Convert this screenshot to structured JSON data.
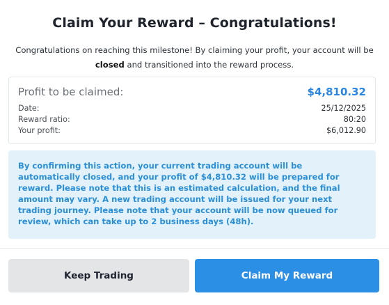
{
  "dialog": {
    "title": "Claim Your Reward – Congratulations!",
    "subtitle_part1": "Congratulations on reaching this milestone! By claiming your profit, your account will be ",
    "subtitle_bold": "closed",
    "subtitle_part2": " and transitioned into the reward process."
  },
  "summary": {
    "label": "Profit to be claimed:",
    "value": "$4,810.32",
    "rows": [
      {
        "key": "Date:",
        "value": "25/12/2025"
      },
      {
        "key": "Reward ratio:",
        "value": "80:20"
      },
      {
        "key": "Your profit:",
        "value": "$6,012.90"
      }
    ]
  },
  "notice": {
    "text": "By confirming this action, your current trading account will be automatically closed, and your profit of $4,810.32 will be prepared for reward. Please note that this is an estimated calculation, and the final amount may vary. A new trading account will be issued for your next trading journey. Please note that your account will be now queued for review, which can take up to 2 business days (48h)."
  },
  "buttons": {
    "keep_label": "Keep Trading",
    "claim_label": "Claim My Reward"
  },
  "colors": {
    "accent": "#2b8fe6",
    "notice_bg": "#e3f1fb",
    "notice_text": "#2b8fd6",
    "secondary_button": "#e4e5e7"
  }
}
